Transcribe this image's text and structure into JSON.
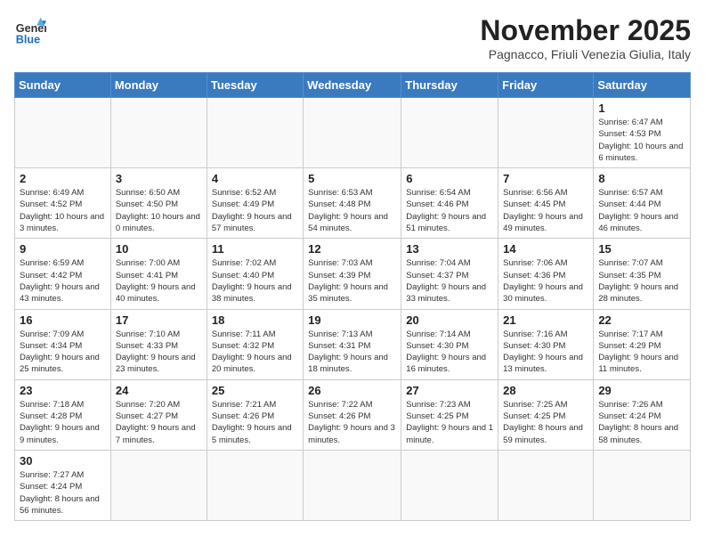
{
  "header": {
    "logo_general": "General",
    "logo_blue": "Blue",
    "month_title": "November 2025",
    "location": "Pagnacco, Friuli Venezia Giulia, Italy"
  },
  "days_of_week": [
    "Sunday",
    "Monday",
    "Tuesday",
    "Wednesday",
    "Thursday",
    "Friday",
    "Saturday"
  ],
  "weeks": [
    [
      {
        "day": "",
        "info": ""
      },
      {
        "day": "",
        "info": ""
      },
      {
        "day": "",
        "info": ""
      },
      {
        "day": "",
        "info": ""
      },
      {
        "day": "",
        "info": ""
      },
      {
        "day": "",
        "info": ""
      },
      {
        "day": "1",
        "info": "Sunrise: 6:47 AM\nSunset: 4:53 PM\nDaylight: 10 hours and 6 minutes."
      }
    ],
    [
      {
        "day": "2",
        "info": "Sunrise: 6:49 AM\nSunset: 4:52 PM\nDaylight: 10 hours and 3 minutes."
      },
      {
        "day": "3",
        "info": "Sunrise: 6:50 AM\nSunset: 4:50 PM\nDaylight: 10 hours and 0 minutes."
      },
      {
        "day": "4",
        "info": "Sunrise: 6:52 AM\nSunset: 4:49 PM\nDaylight: 9 hours and 57 minutes."
      },
      {
        "day": "5",
        "info": "Sunrise: 6:53 AM\nSunset: 4:48 PM\nDaylight: 9 hours and 54 minutes."
      },
      {
        "day": "6",
        "info": "Sunrise: 6:54 AM\nSunset: 4:46 PM\nDaylight: 9 hours and 51 minutes."
      },
      {
        "day": "7",
        "info": "Sunrise: 6:56 AM\nSunset: 4:45 PM\nDaylight: 9 hours and 49 minutes."
      },
      {
        "day": "8",
        "info": "Sunrise: 6:57 AM\nSunset: 4:44 PM\nDaylight: 9 hours and 46 minutes."
      }
    ],
    [
      {
        "day": "9",
        "info": "Sunrise: 6:59 AM\nSunset: 4:42 PM\nDaylight: 9 hours and 43 minutes."
      },
      {
        "day": "10",
        "info": "Sunrise: 7:00 AM\nSunset: 4:41 PM\nDaylight: 9 hours and 40 minutes."
      },
      {
        "day": "11",
        "info": "Sunrise: 7:02 AM\nSunset: 4:40 PM\nDaylight: 9 hours and 38 minutes."
      },
      {
        "day": "12",
        "info": "Sunrise: 7:03 AM\nSunset: 4:39 PM\nDaylight: 9 hours and 35 minutes."
      },
      {
        "day": "13",
        "info": "Sunrise: 7:04 AM\nSunset: 4:37 PM\nDaylight: 9 hours and 33 minutes."
      },
      {
        "day": "14",
        "info": "Sunrise: 7:06 AM\nSunset: 4:36 PM\nDaylight: 9 hours and 30 minutes."
      },
      {
        "day": "15",
        "info": "Sunrise: 7:07 AM\nSunset: 4:35 PM\nDaylight: 9 hours and 28 minutes."
      }
    ],
    [
      {
        "day": "16",
        "info": "Sunrise: 7:09 AM\nSunset: 4:34 PM\nDaylight: 9 hours and 25 minutes."
      },
      {
        "day": "17",
        "info": "Sunrise: 7:10 AM\nSunset: 4:33 PM\nDaylight: 9 hours and 23 minutes."
      },
      {
        "day": "18",
        "info": "Sunrise: 7:11 AM\nSunset: 4:32 PM\nDaylight: 9 hours and 20 minutes."
      },
      {
        "day": "19",
        "info": "Sunrise: 7:13 AM\nSunset: 4:31 PM\nDaylight: 9 hours and 18 minutes."
      },
      {
        "day": "20",
        "info": "Sunrise: 7:14 AM\nSunset: 4:30 PM\nDaylight: 9 hours and 16 minutes."
      },
      {
        "day": "21",
        "info": "Sunrise: 7:16 AM\nSunset: 4:30 PM\nDaylight: 9 hours and 13 minutes."
      },
      {
        "day": "22",
        "info": "Sunrise: 7:17 AM\nSunset: 4:29 PM\nDaylight: 9 hours and 11 minutes."
      }
    ],
    [
      {
        "day": "23",
        "info": "Sunrise: 7:18 AM\nSunset: 4:28 PM\nDaylight: 9 hours and 9 minutes."
      },
      {
        "day": "24",
        "info": "Sunrise: 7:20 AM\nSunset: 4:27 PM\nDaylight: 9 hours and 7 minutes."
      },
      {
        "day": "25",
        "info": "Sunrise: 7:21 AM\nSunset: 4:26 PM\nDaylight: 9 hours and 5 minutes."
      },
      {
        "day": "26",
        "info": "Sunrise: 7:22 AM\nSunset: 4:26 PM\nDaylight: 9 hours and 3 minutes."
      },
      {
        "day": "27",
        "info": "Sunrise: 7:23 AM\nSunset: 4:25 PM\nDaylight: 9 hours and 1 minute."
      },
      {
        "day": "28",
        "info": "Sunrise: 7:25 AM\nSunset: 4:25 PM\nDaylight: 8 hours and 59 minutes."
      },
      {
        "day": "29",
        "info": "Sunrise: 7:26 AM\nSunset: 4:24 PM\nDaylight: 8 hours and 58 minutes."
      }
    ],
    [
      {
        "day": "30",
        "info": "Sunrise: 7:27 AM\nSunset: 4:24 PM\nDaylight: 8 hours and 56 minutes."
      },
      {
        "day": "",
        "info": ""
      },
      {
        "day": "",
        "info": ""
      },
      {
        "day": "",
        "info": ""
      },
      {
        "day": "",
        "info": ""
      },
      {
        "day": "",
        "info": ""
      },
      {
        "day": "",
        "info": ""
      }
    ]
  ]
}
